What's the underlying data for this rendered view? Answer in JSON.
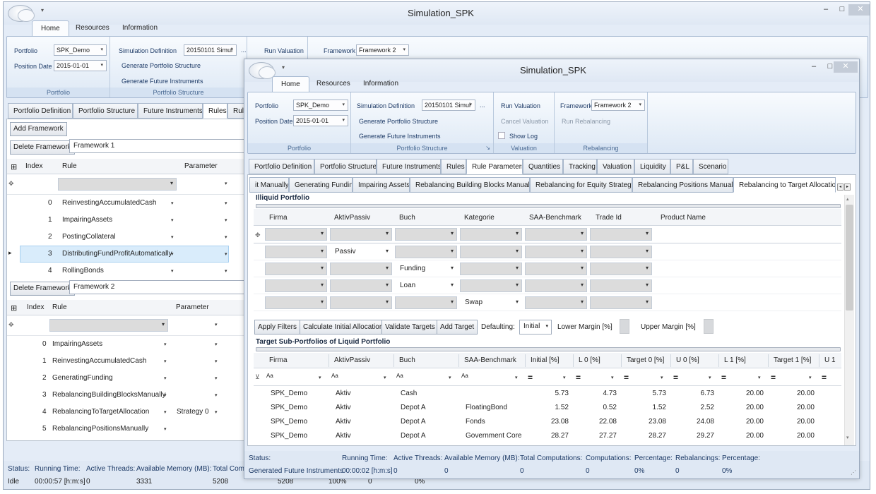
{
  "app": {
    "title": "Simulation_SPK",
    "qa_arrow": "▾"
  },
  "icons": {
    "minimize": "–",
    "maximize": "□",
    "close": "✕",
    "dropdown": "▾",
    "row_marker": "✥",
    "current_row": "▸",
    "grid_settings": "⊞",
    "filter": "⊻",
    "text_filter": "Aa",
    "eq_filter": "="
  },
  "ribbon_tabs": [
    "Home",
    "Resources",
    "Information"
  ],
  "back": {
    "ribbon": {
      "portfolio_label": "Portfolio",
      "portfolio_value": "SPK_Demo",
      "position_date_label": "Position Date",
      "position_date_value": "2015-01-01",
      "portfolio_group": "Portfolio",
      "sim_def_label": "Simulation Definition",
      "sim_def_value": "20150101 Simul",
      "more": "...",
      "gen_portfolio": "Generate Portfolio Structure",
      "gen_future": "Generate Future Instruments",
      "portfolio_structure_group": "Portfolio Structure",
      "run_valuation": "Run Valuation",
      "framework_label": "Framework",
      "framework_value": "Framework 2"
    },
    "tabs": [
      "Portfolio Definition",
      "Portfolio Structure",
      "Future Instruments",
      "Rules",
      "Rule"
    ],
    "add_framework": "Add Framework",
    "delete_framework": "Delete Framework",
    "fw1_name": "Framework 1",
    "fw2_name": "Framework 2",
    "cols": {
      "index": "Index",
      "rule": "Rule",
      "parameter": "Parameter"
    },
    "fw1_rows": [
      {
        "i": "0",
        "r": "ReinvestingAccumulatedCash"
      },
      {
        "i": "1",
        "r": "ImpairingAssets"
      },
      {
        "i": "2",
        "r": "PostingCollateral"
      },
      {
        "i": "3",
        "r": "DistributingFundProfitAutomatically"
      },
      {
        "i": "4",
        "r": "RollingBonds"
      }
    ],
    "fw2_rows": [
      {
        "i": "0",
        "r": "ImpairingAssets",
        "p": ""
      },
      {
        "i": "1",
        "r": "ReinvestingAccumulatedCash",
        "p": ""
      },
      {
        "i": "2",
        "r": "GeneratingFunding",
        "p": ""
      },
      {
        "i": "3",
        "r": "RebalancingBuildingBlocksManually",
        "p": ""
      },
      {
        "i": "4",
        "r": "RebalancingToTargetAllocation",
        "p": "Strategy 0"
      },
      {
        "i": "5",
        "r": "RebalancingPositionsManually",
        "p": ""
      }
    ],
    "status": {
      "status": "Status:",
      "running_time": "Running Time:",
      "active_threads": "Active Threads:",
      "available_memory": "Available Memory (MB):",
      "total_comp": "Total Comp",
      "idle": "Idle",
      "time": "00:00:57 [h:m:s]",
      "threads": "0",
      "memory": "3331",
      "total": "5208",
      "obscured_total": "5208",
      "obscured_pct1": "100%",
      "obscured_zero": "0",
      "obscured_pct2": "0%"
    }
  },
  "front": {
    "ribbon": {
      "portfolio_label": "Portfolio",
      "portfolio_value": "SPK_Demo",
      "position_date_label": "Position Date",
      "position_date_value": "2015-01-01",
      "portfolio_group": "Portfolio",
      "sim_def_label": "Simulation Definition",
      "sim_def_value": "20150101 Simul",
      "more": "...",
      "gen_portfolio": "Generate Portfolio Structure",
      "gen_future": "Generate Future Instruments",
      "portfolio_structure_group": "Portfolio Structure",
      "run_valuation": "Run Valuation",
      "cancel_valuation": "Cancel Valuation",
      "show_log": "Show Log",
      "valuation_group": "Valuation",
      "framework_label": "Framework",
      "framework_value": "Framework 2",
      "run_rebalancing": "Run Rebalancing",
      "rebalancing_group": "Rebalancing",
      "launcher": "↘"
    },
    "tabs": [
      "Portfolio Definition",
      "Portfolio Structure",
      "Future Instruments",
      "Rules",
      "Rule Parameters",
      "Quantities",
      "Tracking",
      "Valuation",
      "Liquidity",
      "P&L",
      "Scenario"
    ],
    "subtabs": [
      "it Manually",
      "Generating Funding",
      "Impairing Assets",
      "Rebalancing Building Blocks Manually",
      "Rebalancing for Equity Strategy",
      "Rebalancing Positions Manually",
      "Rebalancing to Target Allocation"
    ],
    "illiquid_title": "Illiquid Portfolio",
    "illiquid_cols": [
      "Firma",
      "AktivPassiv",
      "Buch",
      "Kategorie",
      "SAA-Benchmark",
      "Trade Id",
      "Product Name"
    ],
    "illiquid_rows": [
      [
        "",
        "Passiv",
        "",
        "",
        "",
        "",
        ""
      ],
      [
        "",
        "",
        "Funding",
        "",
        "",
        "",
        ""
      ],
      [
        "",
        "",
        "Loan",
        "",
        "",
        "",
        ""
      ],
      [
        "",
        "",
        "",
        "Swap",
        "",
        "",
        ""
      ]
    ],
    "buttons": {
      "apply_filters": "Apply Filters",
      "calc_initial": "Calculate Initial Allocation",
      "validate_targets": "Validate Targets",
      "add_target": "Add Target"
    },
    "defaulting_label": "Defaulting:",
    "defaulting_value": "Initial",
    "lower_margin": "Lower Margin [%]",
    "upper_margin": "Upper Margin [%]",
    "target_title": "Target Sub-Portfolios of Liquid Portfolio",
    "target_cols": [
      "Firma",
      "AktivPassiv",
      "Buch",
      "SAA-Benchmark",
      "Initial [%]",
      "L 0 [%]",
      "Target 0 [%]",
      "U 0 [%]",
      "L 1 [%]",
      "Target 1 [%]",
      "U 1"
    ],
    "target_rows": [
      [
        "SPK_Demo",
        "Aktiv",
        "Cash",
        "",
        "5.73",
        "4.73",
        "5.73",
        "6.73",
        "20.00",
        "20.00"
      ],
      [
        "SPK_Demo",
        "Aktiv",
        "Depot A",
        "FloatingBond",
        "1.52",
        "0.52",
        "1.52",
        "2.52",
        "20.00",
        "20.00"
      ],
      [
        "SPK_Demo",
        "Aktiv",
        "Depot A",
        "Fonds",
        "23.08",
        "22.08",
        "23.08",
        "24.08",
        "20.00",
        "20.00"
      ],
      [
        "SPK_Demo",
        "Aktiv",
        "Depot A",
        "Government Core",
        "28.27",
        "27.27",
        "28.27",
        "29.27",
        "20.00",
        "20.00"
      ]
    ],
    "status": {
      "status": "Status:",
      "running_time": "Running Time:",
      "active_threads": "Active Threads:",
      "available_memory": "Available Memory (MB):",
      "total_computations": "Total Computations:",
      "computations": "Computations:",
      "percentage": "Percentage:",
      "rebalancings": "Rebalancings:",
      "percentage2": "Percentage:",
      "state": "Generated Future Instruments",
      "time": "00:00:02 [h:m:s]",
      "threads": "0",
      "memory": "0",
      "total": "0",
      "comp": "0",
      "pct": "0%",
      "reb": "0",
      "pct2": "0%"
    }
  },
  "colors": {
    "ribbon_bg": "#dde8f5",
    "window_bg": "#e4ecf7",
    "selected_row": "#d9ecfb",
    "status_text": "#1d3a66"
  }
}
